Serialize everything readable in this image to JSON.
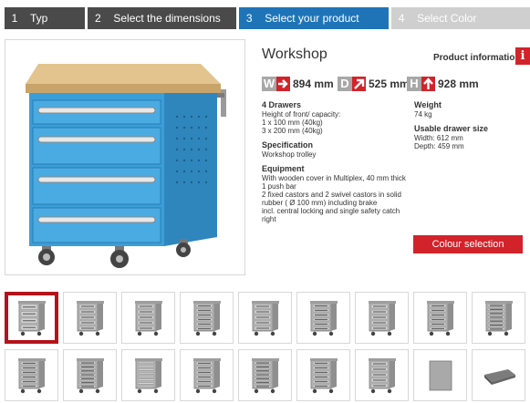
{
  "steps": [
    {
      "num": "1",
      "label": "Typ"
    },
    {
      "num": "2",
      "label": "Select the dimensions"
    },
    {
      "num": "3",
      "label": "Select your product"
    },
    {
      "num": "4",
      "label": "Select Color"
    }
  ],
  "product": {
    "title": "Workshop",
    "info_link": "Product information",
    "info_icon": "i",
    "dims": {
      "w": {
        "letter": "W",
        "value": "894 mm"
      },
      "d": {
        "letter": "D",
        "value": "525 mm"
      },
      "h": {
        "letter": "H",
        "value": "928 mm"
      }
    },
    "drawers": {
      "heading": "4 Drawers",
      "lines": [
        "Height of front/ capacity:",
        "1 x 100 mm (40kg)",
        "3 x 200 mm (40kg)"
      ]
    },
    "specification": {
      "heading": "Specification",
      "lines": [
        "Workshop trolley"
      ]
    },
    "equipment": {
      "heading": "Equipment",
      "lines": [
        "With wooden cover in Multiplex, 40 mm thick",
        "1 push bar",
        "2 fixed castors and 2 swivel castors in solid",
        "rubber ( Ø 100 mm) including brake",
        "incl. central locking and single safety catch",
        "right"
      ]
    },
    "weight": {
      "heading": "Weight",
      "lines": [
        "74 kg"
      ]
    },
    "usable": {
      "heading": "Usable drawer size",
      "lines": [
        "Width: 612 mm",
        "Depth: 459 mm"
      ]
    },
    "colour_button": "Colour selection"
  },
  "colors": {
    "accent_red": "#d2232a",
    "step_active": "#1f74b8",
    "step_dark": "#4a4a4a",
    "cabinet_blue": "#3a9ed9"
  }
}
